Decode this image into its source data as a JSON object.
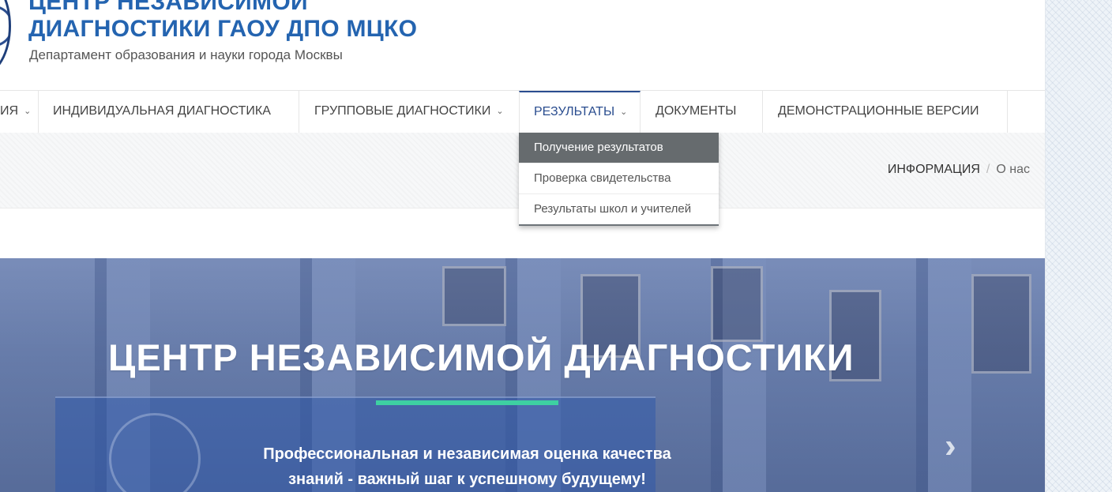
{
  "header": {
    "title_line1": "ЦЕНТР НЕЗАВИСИМОЙ",
    "title_line2": "ДИАГНОСТИКИ ГАОУ ДПО МЦКО",
    "subtitle": "Департамент образования и науки города Москвы"
  },
  "nav": {
    "items": [
      {
        "label": "ИЯ",
        "has_dropdown": true
      },
      {
        "label": "ИНДИВИДУАЛЬНАЯ ДИАГНОСТИКА",
        "has_dropdown": false
      },
      {
        "label": "ГРУППОВЫЕ ДИАГНОСТИКИ",
        "has_dropdown": true
      },
      {
        "label": "РЕЗУЛЬТАТЫ",
        "has_dropdown": true,
        "active": true
      },
      {
        "label": "ДОКУМЕНТЫ",
        "has_dropdown": false
      },
      {
        "label": "ДЕМОНСТРАЦИОННЫЕ ВЕРСИИ",
        "has_dropdown": false
      }
    ],
    "chevron": "⌄",
    "active_color": "#2a4d8f"
  },
  "dropdown": {
    "items": [
      {
        "label": "Получение результатов",
        "highlighted": true
      },
      {
        "label": "Проверка свидетельства"
      },
      {
        "label": "Результаты школ и учителей"
      }
    ]
  },
  "breadcrumb": {
    "items": [
      "ИНФОРМАЦИЯ",
      "О нас"
    ],
    "separator": "/"
  },
  "hero": {
    "title": "ЦЕНТР НЕЗАВИСИМОЙ ДИАГНОСТИКИ",
    "text_line1": "Профессиональная и независимая оценка качества",
    "text_line2": "знаний - важный шаг к успешному будущему!",
    "next_arrow": "›",
    "accent_color": "#3ed0a2"
  }
}
